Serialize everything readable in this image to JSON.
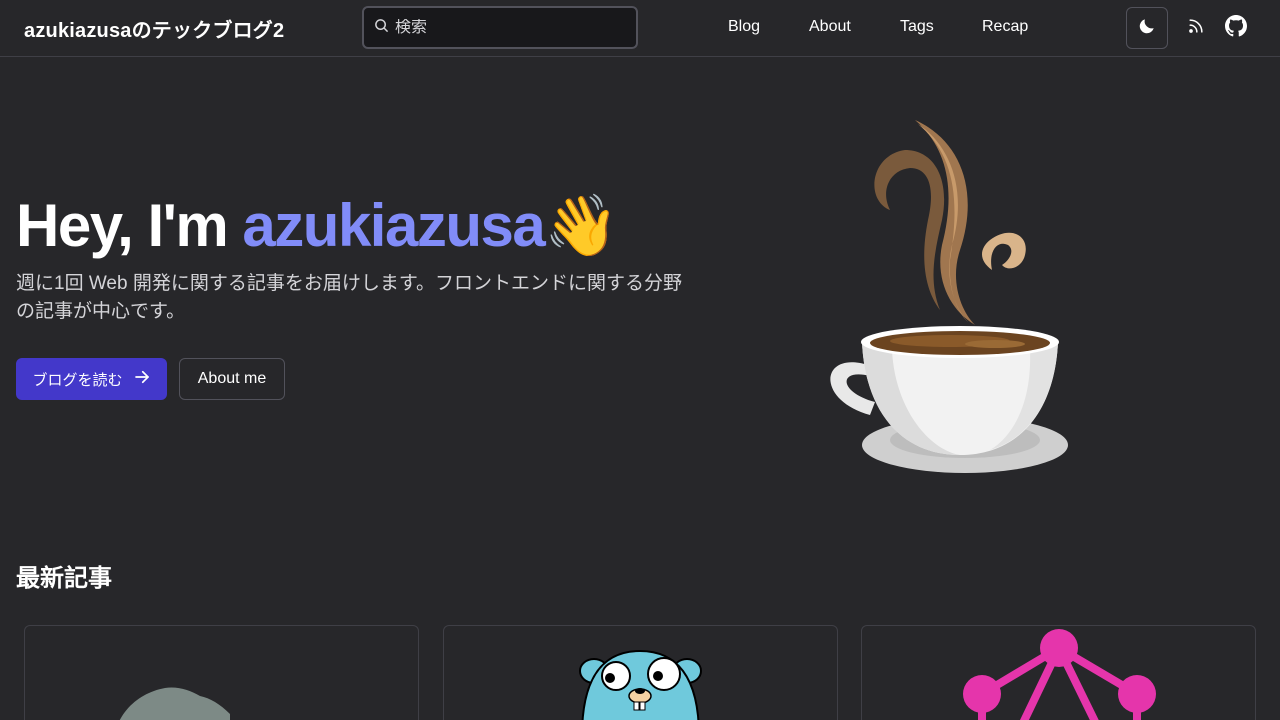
{
  "header": {
    "site_title": "azukiazusaのテックブログ2",
    "search": {
      "placeholder": "検索",
      "icon": "search-icon"
    },
    "nav": [
      {
        "label": "Blog"
      },
      {
        "label": "About"
      },
      {
        "label": "Tags"
      },
      {
        "label": "Recap"
      }
    ],
    "theme_toggle_icon": "moon-icon",
    "rss_icon": "rss-icon",
    "github_icon": "github-icon"
  },
  "hero": {
    "greeting": "Hey, I'm ",
    "name": "azukiazusa",
    "emoji": "👋",
    "description": "週に1回 Web 開発に関する記事をお届けします。フロントエンドに関する分野の記事が中心です。",
    "primary_button": "ブログを読む",
    "secondary_button": "About me"
  },
  "latest": {
    "title": "最新記事"
  },
  "colors": {
    "background": "#27272a",
    "accent": "#818cf8",
    "primary_button": "#4338ca",
    "border": "#3f3f46"
  }
}
